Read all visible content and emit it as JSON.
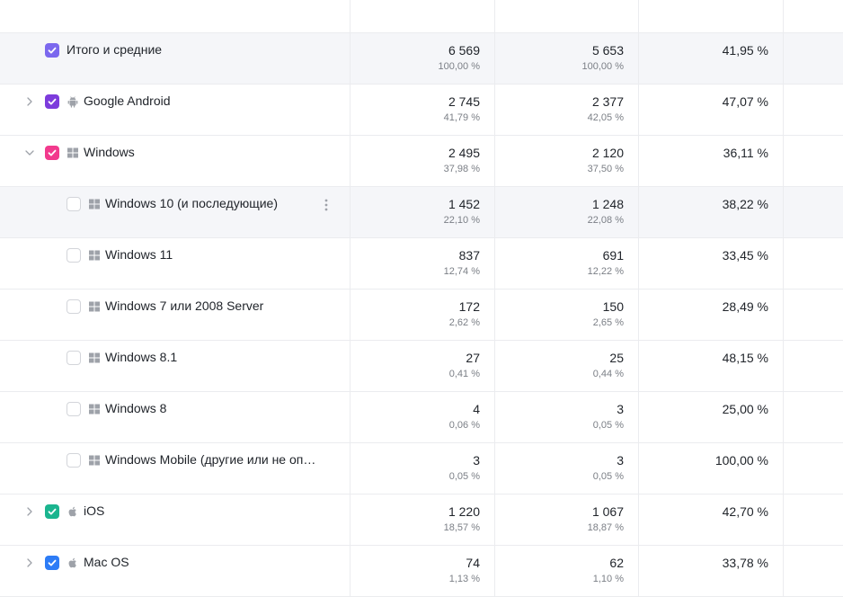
{
  "table": {
    "rows": [
      {
        "label": "Итого и средние",
        "c1": "6 569",
        "c1sub": "100,00 %",
        "c2": "5 653",
        "c2sub": "100,00 %",
        "c3": "41,95 %",
        "checkbox": "#7b68ee",
        "checked": true,
        "icon": "",
        "expand": "",
        "indent": 0,
        "highlight": true
      },
      {
        "label": "Google Android",
        "c1": "2 745",
        "c1sub": "41,79 %",
        "c2": "2 377",
        "c2sub": "42,05 %",
        "c3": "47,07 %",
        "checkbox": "#7d3cdc",
        "checked": true,
        "icon": "android-icon",
        "expand": "collapsed",
        "indent": 0,
        "highlight": false
      },
      {
        "label": "Windows",
        "c1": "2 495",
        "c1sub": "37,98 %",
        "c2": "2 120",
        "c2sub": "37,50 %",
        "c3": "36,11 %",
        "checkbox": "#f23a8d",
        "checked": true,
        "icon": "windows-icon",
        "expand": "expanded",
        "indent": 0,
        "highlight": false
      },
      {
        "label": "Windows 10 (и последующие)",
        "c1": "1 452",
        "c1sub": "22,10 %",
        "c2": "1 248",
        "c2sub": "22,08 %",
        "c3": "38,22 %",
        "checkbox": "",
        "checked": false,
        "icon": "windows-icon",
        "expand": "",
        "indent": 1,
        "highlight": true,
        "menu": true
      },
      {
        "label": "Windows 11",
        "c1": "837",
        "c1sub": "12,74 %",
        "c2": "691",
        "c2sub": "12,22 %",
        "c3": "33,45 %",
        "checkbox": "",
        "checked": false,
        "icon": "windows-icon",
        "expand": "",
        "indent": 1,
        "highlight": false
      },
      {
        "label": "Windows 7 или 2008 Server",
        "c1": "172",
        "c1sub": "2,62 %",
        "c2": "150",
        "c2sub": "2,65 %",
        "c3": "28,49 %",
        "checkbox": "",
        "checked": false,
        "icon": "windows-icon",
        "expand": "",
        "indent": 1,
        "highlight": false
      },
      {
        "label": "Windows 8.1",
        "c1": "27",
        "c1sub": "0,41 %",
        "c2": "25",
        "c2sub": "0,44 %",
        "c3": "48,15 %",
        "checkbox": "",
        "checked": false,
        "icon": "windows-icon",
        "expand": "",
        "indent": 1,
        "highlight": false
      },
      {
        "label": "Windows 8",
        "c1": "4",
        "c1sub": "0,06 %",
        "c2": "3",
        "c2sub": "0,05 %",
        "c3": "25,00 %",
        "checkbox": "",
        "checked": false,
        "icon": "windows-icon",
        "expand": "",
        "indent": 1,
        "highlight": false
      },
      {
        "label": "Windows Mobile (другие или не оп…",
        "c1": "3",
        "c1sub": "0,05 %",
        "c2": "3",
        "c2sub": "0,05 %",
        "c3": "100,00 %",
        "checkbox": "",
        "checked": false,
        "icon": "windows-icon",
        "expand": "",
        "indent": 1,
        "highlight": false
      },
      {
        "label": "iOS",
        "c1": "1 220",
        "c1sub": "18,57 %",
        "c2": "1 067",
        "c2sub": "18,87 %",
        "c3": "42,70 %",
        "checkbox": "#1bb58f",
        "checked": true,
        "icon": "apple-icon",
        "expand": "collapsed",
        "indent": 0,
        "highlight": false
      },
      {
        "label": "Mac OS",
        "c1": "74",
        "c1sub": "1,13 %",
        "c2": "62",
        "c2sub": "1,10 %",
        "c3": "33,78 %",
        "checkbox": "#2d7cf6",
        "checked": true,
        "icon": "apple-icon",
        "expand": "collapsed",
        "indent": 0,
        "highlight": false
      }
    ]
  },
  "colors": {
    "icon": "#9ea2a9",
    "border": "#ebecef",
    "highlight": "#f5f6f9"
  }
}
